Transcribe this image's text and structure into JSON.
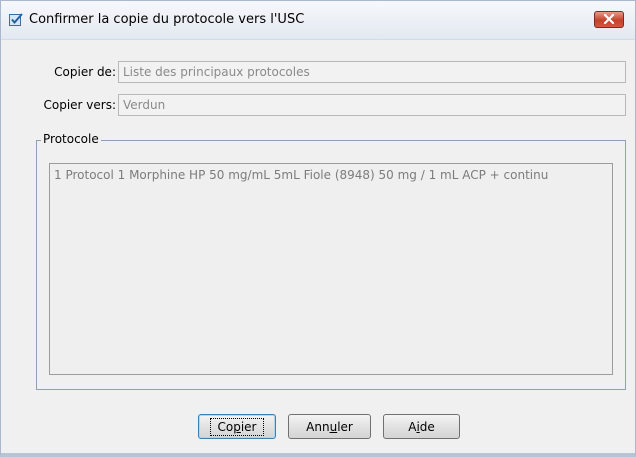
{
  "dialog": {
    "title": "Confirmer la copie du protocole vers l'USC"
  },
  "form": {
    "copy_from_label": "Copier de:",
    "copy_from_value": "Liste des principaux protocoles",
    "copy_to_label": "Copier vers:",
    "copy_to_value": "Verdun"
  },
  "protocol_group": {
    "legend": "Protocole",
    "items": [
      "1 Protocol 1 Morphine HP  50 mg/mL  5mL Fiole (8948) 50 mg / 1 mL ACP + continu"
    ]
  },
  "buttons": {
    "copy": {
      "before": "Co",
      "mnemonic": "p",
      "after": "ier"
    },
    "cancel": {
      "before": "Ann",
      "mnemonic": "u",
      "after": "ler"
    },
    "help": {
      "before": "A",
      "mnemonic": "i",
      "after": "de"
    }
  },
  "colors": {
    "close_button": "#c5412b",
    "frame": "#a9b8cc",
    "group_border": "#8ea0b6"
  },
  "icons": {
    "app": "checkbox-check-icon",
    "close": "close-icon"
  }
}
